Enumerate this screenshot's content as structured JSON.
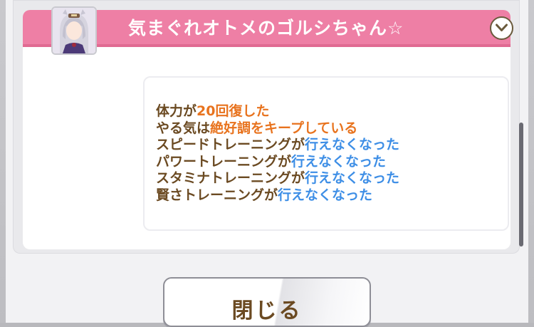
{
  "event_card": {
    "title": "気まぐれオトメのゴルシちゃん☆",
    "header_color": "#ee7fa5",
    "avatar_icon": "character-portrait-icon",
    "collapse_icon": "chevron-down-icon"
  },
  "effects": [
    {
      "segments": [
        {
          "text": "体力が",
          "tone": "brown"
        },
        {
          "text": "20回復した",
          "tone": "orange"
        }
      ]
    },
    {
      "segments": [
        {
          "text": "やる気は",
          "tone": "brown"
        },
        {
          "text": "絶好調をキープしている",
          "tone": "orange"
        }
      ]
    },
    {
      "segments": [
        {
          "text": "スピードトレーニングが",
          "tone": "brown"
        },
        {
          "text": "行えなくなった",
          "tone": "blue"
        }
      ]
    },
    {
      "segments": [
        {
          "text": "パワートレーニングが",
          "tone": "brown"
        },
        {
          "text": "行えなくなった",
          "tone": "blue"
        }
      ]
    },
    {
      "segments": [
        {
          "text": "スタミナトレーニングが",
          "tone": "brown"
        },
        {
          "text": "行えなくなった",
          "tone": "blue"
        }
      ]
    },
    {
      "segments": [
        {
          "text": "賢さトレーニングが",
          "tone": "brown"
        },
        {
          "text": "行えなくなった",
          "tone": "blue"
        }
      ]
    }
  ],
  "colors": {
    "text_brown": "#6b4a22",
    "text_orange": "#e8731e",
    "text_blue": "#3d8ee6"
  },
  "footer": {
    "close_label": "閉じる"
  }
}
